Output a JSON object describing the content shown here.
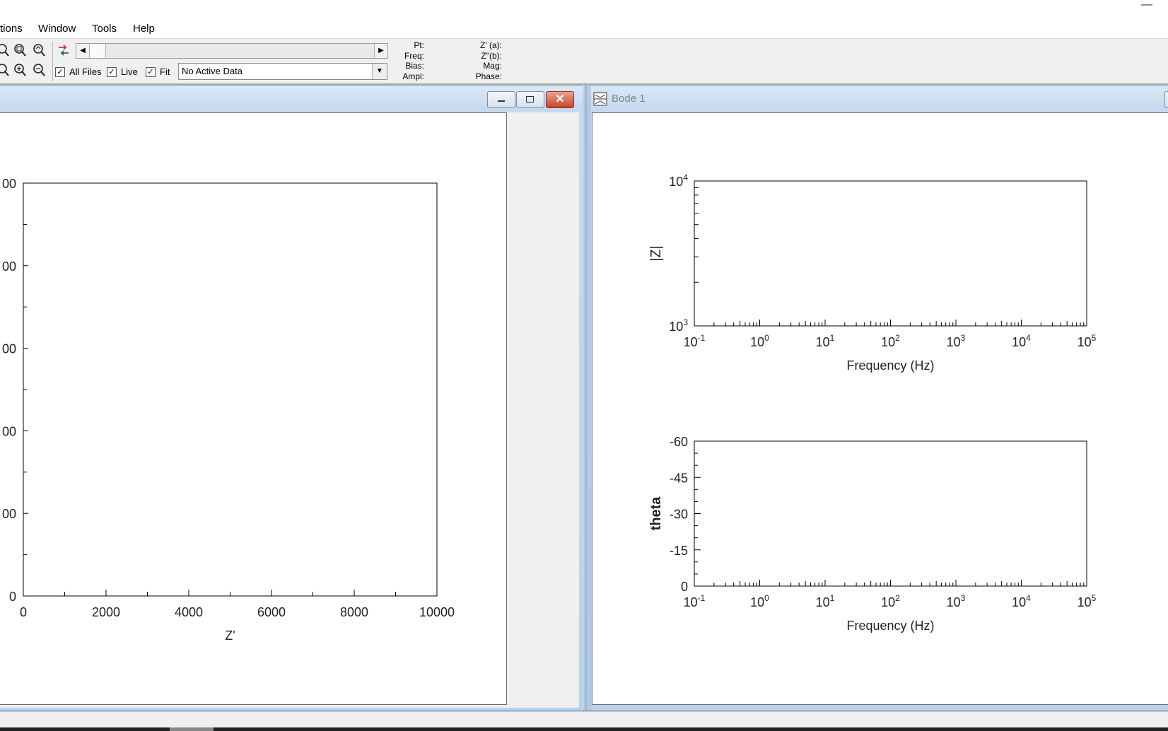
{
  "title_bar": {
    "minimize_glyph": "—"
  },
  "menu": {
    "options": "tions",
    "window": "Window",
    "tools": "Tools",
    "help": "Help"
  },
  "toolbar": {
    "zoom_icons_row1": [
      "zoom-in-icon",
      "zoom-region-icon",
      "zoom-fit-icon"
    ],
    "zoom_icons_row2": [
      "zoom-out-icon",
      "zoom-in-icon",
      "zoom-out-icon"
    ],
    "swap_icon": "swap-arrows-icon",
    "all_files_label": "All Files",
    "all_files_checked": true,
    "live_label": "Live",
    "live_checked": true,
    "fit_label": "Fit",
    "fit_checked": true,
    "data_select_value": "No Active Data",
    "readouts_left": [
      "Pt:",
      "Freq:",
      "Bias:",
      "Ampl:"
    ],
    "readouts_right": [
      "Z' (a):",
      "Z\"(b):",
      "Mag:",
      "Phase:"
    ]
  },
  "left_window": {
    "chart_data": {
      "type": "scatter",
      "xlabel": "Z'",
      "ylabel": "",
      "xlim": [
        0,
        10000
      ],
      "x_ticks": [
        "0",
        "2000",
        "4000",
        "6000",
        "8000",
        "10000"
      ],
      "y_ticks_visible": [
        "00",
        "00",
        "00",
        "00",
        "00",
        "0"
      ],
      "series": []
    }
  },
  "right_window": {
    "title": "Bode 1",
    "icon": "bode-plot-icon",
    "top_chart": {
      "chart_data": {
        "type": "line",
        "xlabel": "Frequency (Hz)",
        "ylabel": "|Z|",
        "x_scale": "log",
        "y_scale": "log",
        "xlim": [
          0.1,
          100000
        ],
        "ylim": [
          1000,
          10000
        ],
        "x_tick_base": "10",
        "x_tick_exps": [
          "-1",
          "0",
          "1",
          "2",
          "3",
          "4",
          "5"
        ],
        "y_tick_base": "10",
        "y_tick_exps": [
          "3",
          "4"
        ],
        "series": []
      }
    },
    "bottom_chart": {
      "chart_data": {
        "type": "line",
        "xlabel": "Frequency (Hz)",
        "ylabel": "theta",
        "x_scale": "log",
        "xlim": [
          0.1,
          100000
        ],
        "ylim": [
          0,
          -60
        ],
        "x_tick_base": "10",
        "x_tick_exps": [
          "-1",
          "0",
          "1",
          "2",
          "3",
          "4",
          "5"
        ],
        "y_ticks": [
          "-60",
          "-45",
          "-30",
          "-15",
          "0"
        ],
        "series": []
      }
    }
  }
}
